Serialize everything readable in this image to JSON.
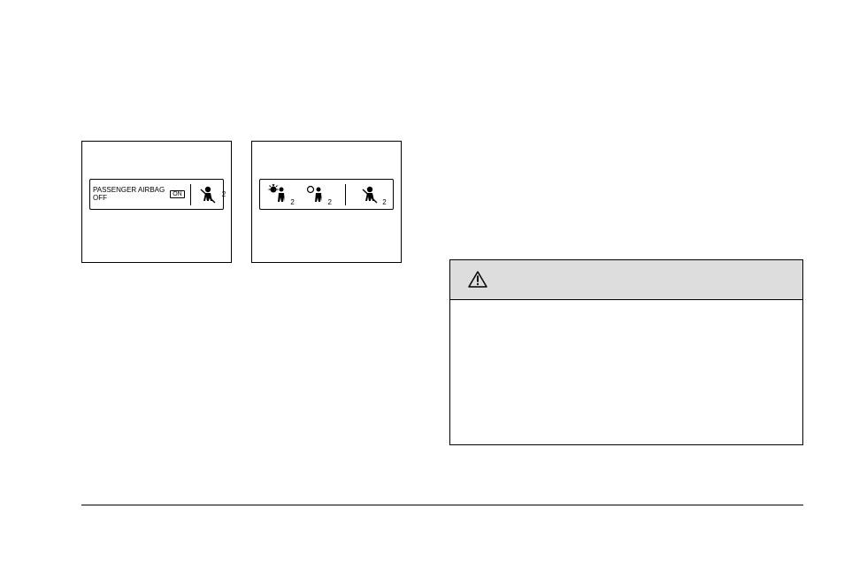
{
  "figures": {
    "panel1": {
      "line1": "PASSENGER AIRBAG",
      "line2": "OFF",
      "onLabel": "ON",
      "seatbeltNum": "2"
    },
    "panel2": {
      "icon1Num": "2",
      "icon2Num": "2",
      "icon3Num": "2"
    }
  },
  "caution": {
    "header": ""
  }
}
